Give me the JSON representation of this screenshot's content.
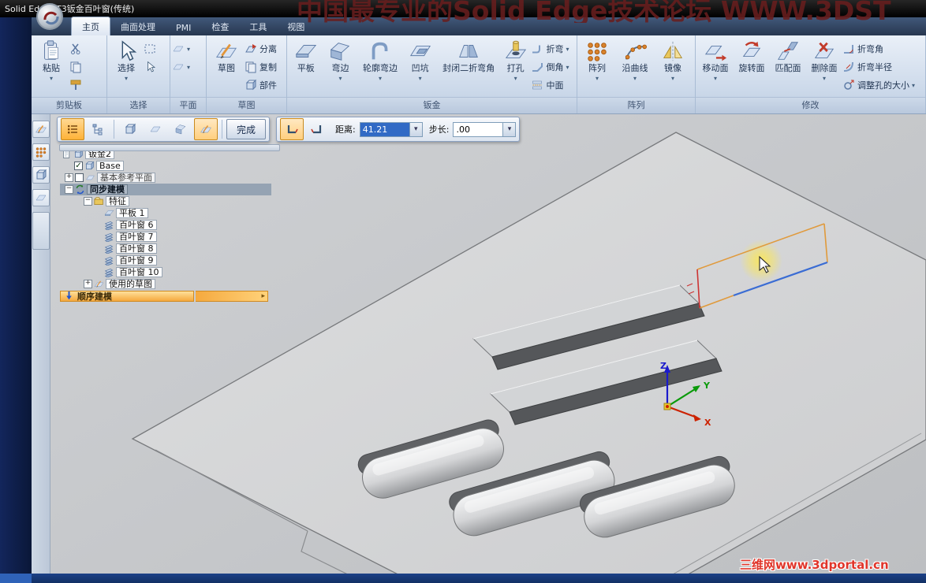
{
  "window": {
    "title": "Solid EdgeST3钣金百叶窗(传统)"
  },
  "watermarks": {
    "top": "中国最专业的Solid Edge技术论坛 WWW.3DST",
    "bottom": "三维网www.3dportal.cn"
  },
  "ribbon": {
    "tabs": [
      {
        "label": "主页"
      },
      {
        "label": "曲面处理"
      },
      {
        "label": "PMI"
      },
      {
        "label": "检查"
      },
      {
        "label": "工具"
      },
      {
        "label": "视图"
      }
    ],
    "groups": [
      {
        "label": "剪贴板",
        "buttons": [
          {
            "label": "粘贴",
            "icon": "paste-icon"
          }
        ]
      },
      {
        "label": "选择",
        "buttons": [
          {
            "label": "选择",
            "icon": "select-cursor-icon"
          }
        ]
      },
      {
        "label": "平面"
      },
      {
        "label": "草图",
        "buttons": [
          {
            "label": "草图",
            "icon": "sketch-icon"
          }
        ],
        "minirows": [
          {
            "label": "分离",
            "icon": "detach-icon"
          },
          {
            "label": "复制",
            "icon": "copy-icon"
          },
          {
            "label": "部件",
            "icon": "part-icon"
          }
        ]
      },
      {
        "label": "钣金",
        "buttons": [
          {
            "label": "平板",
            "icon": "tab-icon"
          },
          {
            "label": "弯边",
            "icon": "flange-icon"
          },
          {
            "label": "轮廓弯边",
            "icon": "contour-flange-icon"
          },
          {
            "label": "凹坑",
            "icon": "dimple-icon"
          },
          {
            "label": "封闭二折弯角",
            "icon": "close-corner-icon"
          },
          {
            "label": "打孔",
            "icon": "hole-icon"
          }
        ],
        "minirows": [
          {
            "label": "折弯",
            "icon": "bend-icon"
          },
          {
            "label": "倒角",
            "icon": "chamfer-icon"
          },
          {
            "label": "中面",
            "icon": "mid-face-icon"
          }
        ]
      },
      {
        "label": "阵列",
        "buttons": [
          {
            "label": "阵列",
            "icon": "pattern-icon"
          },
          {
            "label": "沿曲线",
            "icon": "along-curve-icon"
          },
          {
            "label": "镜像",
            "icon": "mirror-icon"
          }
        ]
      },
      {
        "label": "修改",
        "buttons": [
          {
            "label": "移动面",
            "icon": "move-face-icon"
          },
          {
            "label": "旋转面",
            "icon": "rotate-face-icon"
          },
          {
            "label": "匹配面",
            "icon": "match-face-icon"
          },
          {
            "label": "删除面",
            "icon": "delete-face-icon"
          }
        ],
        "minirows": [
          {
            "label": "折弯角",
            "icon": "bend-angle-icon"
          },
          {
            "label": "折弯半径",
            "icon": "bend-radius-icon"
          },
          {
            "label": "调整孔的大小",
            "icon": "resize-hole-icon"
          }
        ]
      }
    ]
  },
  "command_bar": {
    "finish": "完成",
    "distance_label": "距离:",
    "distance_value": "41.21",
    "step_label": "步长:",
    "step_value": ".00"
  },
  "tree": {
    "items": [
      {
        "label": "钣金2"
      },
      {
        "label": "Base"
      },
      {
        "label": "基本参考平面"
      },
      {
        "label": "同步建模"
      },
      {
        "label": "特征"
      },
      {
        "label": "平板 1"
      },
      {
        "label": "百叶窗 6"
      },
      {
        "label": "百叶窗 7"
      },
      {
        "label": "百叶窗 8"
      },
      {
        "label": "百叶窗 9"
      },
      {
        "label": "百叶窗 10"
      },
      {
        "label": "使用的草图"
      },
      {
        "label": "顺序建模"
      }
    ]
  },
  "viewport": {
    "axes": {
      "x": "X",
      "y": "Y",
      "z": "Z"
    }
  }
}
